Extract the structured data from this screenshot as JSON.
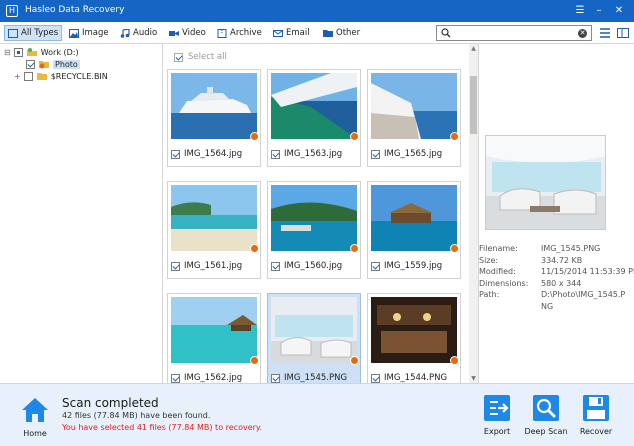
{
  "app": {
    "title": "Hasleo Data Recovery"
  },
  "toolbar": {
    "tabs": [
      {
        "label": "All Types",
        "icon": "all-types-icon",
        "active": true
      },
      {
        "label": "Image",
        "icon": "image-icon"
      },
      {
        "label": "Audio",
        "icon": "audio-icon"
      },
      {
        "label": "Video",
        "icon": "video-icon"
      },
      {
        "label": "Archive",
        "icon": "archive-icon"
      },
      {
        "label": "Email",
        "icon": "email-icon"
      },
      {
        "label": "Other",
        "icon": "folder-icon"
      }
    ],
    "search_value": ""
  },
  "tree": {
    "drive": "Work (D:)",
    "children": [
      {
        "label": "Photo",
        "checked": true
      },
      {
        "label": "$RECYCLE.BIN",
        "checked": false
      }
    ]
  },
  "grid": {
    "select_all": "Select all",
    "files": [
      {
        "name": "IMG_1564.jpg",
        "checked": true,
        "selected": false
      },
      {
        "name": "IMG_1563.jpg",
        "checked": true,
        "selected": false
      },
      {
        "name": "IMG_1565.jpg",
        "checked": true,
        "selected": false
      },
      {
        "name": "IMG_1561.jpg",
        "checked": true,
        "selected": false
      },
      {
        "name": "IMG_1560.jpg",
        "checked": true,
        "selected": false
      },
      {
        "name": "IMG_1559.jpg",
        "checked": true,
        "selected": false
      },
      {
        "name": "IMG_1562.jpg",
        "checked": true,
        "selected": false
      },
      {
        "name": "IMG_1545.PNG",
        "checked": true,
        "selected": true
      },
      {
        "name": "IMG_1544.PNG",
        "checked": true,
        "selected": false
      }
    ]
  },
  "preview": {
    "fields": [
      {
        "key": "Filename:",
        "value": "IMG_1545.PNG"
      },
      {
        "key": "Size:",
        "value": "334.72 KB"
      },
      {
        "key": "Modified:",
        "value": "11/15/2014 11:53:39 PM"
      },
      {
        "key": "Dimensions:",
        "value": "580 x 344"
      },
      {
        "key": "Path:",
        "value": "D:\\Photo\\IMG_1545.P"
      },
      {
        "key": "",
        "value": "NG"
      }
    ]
  },
  "status": {
    "title": "Scan completed",
    "found": "42 files (77.84 MB) have been found.",
    "selected": "You have selected 41 files (77.84 MB) to recovery."
  },
  "buttons": {
    "home": "Home",
    "export": "Export",
    "deep_scan": "Deep Scan",
    "recover": "Recover"
  },
  "colors": {
    "title_bar": "#1565c4",
    "accent": "#1e88e5",
    "warning_text": "#e02020",
    "badge": "#e86a10"
  }
}
